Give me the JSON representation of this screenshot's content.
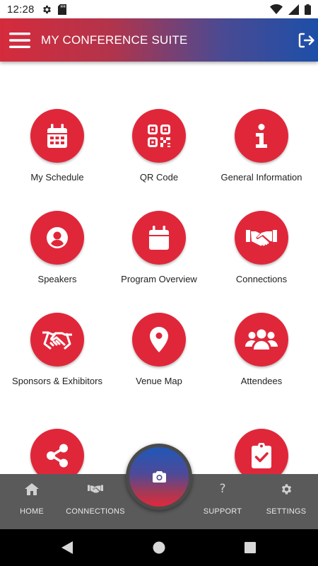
{
  "status_bar": {
    "time": "12:28",
    "icons": [
      "gear-icon",
      "sd-card-icon",
      "wifi-icon",
      "signal-icon",
      "battery-icon"
    ]
  },
  "app_bar": {
    "title": "MY CONFERENCE SUITE",
    "menu_icon": "hamburger-menu-icon",
    "logout_icon": "logout-icon"
  },
  "tiles": [
    {
      "label": "My Schedule",
      "icon": "calendar-grid-icon"
    },
    {
      "label": "QR Code",
      "icon": "qr-code-icon"
    },
    {
      "label": "General Information",
      "icon": "info-icon"
    },
    {
      "label": "Speakers",
      "icon": "user-circle-icon"
    },
    {
      "label": "Program Overview",
      "icon": "calendar-icon"
    },
    {
      "label": "Connections",
      "icon": "handshake-icon"
    },
    {
      "label": "Sponsors & Exhibitors",
      "icon": "handshake-icon"
    },
    {
      "label": "Venue Map",
      "icon": "map-marker-icon"
    },
    {
      "label": "Attendees",
      "icon": "users-icon"
    },
    {
      "label": "",
      "icon": "share-icon"
    },
    {
      "label": "",
      "icon": "clipboard-check-icon"
    }
  ],
  "bottom_nav": {
    "home": {
      "label": "HOME",
      "icon": "home-icon"
    },
    "connections": {
      "label": "CONNECTIONS",
      "icon": "handshake-icon"
    },
    "camera": {
      "icon": "camera-icon"
    },
    "support": {
      "label": "SUPPORT",
      "icon": "?"
    },
    "settings": {
      "label": "SETTINGS",
      "icon": "gear-icon"
    }
  },
  "system_nav": [
    "back-icon",
    "home-circle-icon",
    "recents-icon"
  ],
  "colors": {
    "accent_red": "#e0273a",
    "accent_blue": "#1d4fa8",
    "bottom_nav_bg": "#5a5a5a"
  }
}
